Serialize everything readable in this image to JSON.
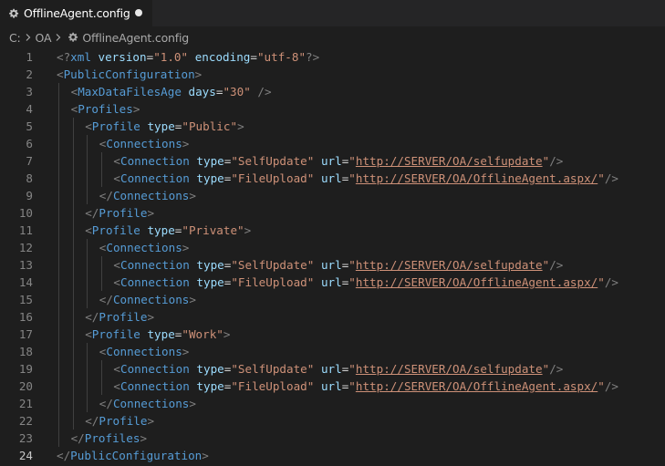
{
  "tab": {
    "title": "OfflineAgent.config",
    "icon": "gear-icon",
    "unsaved": true
  },
  "breadcrumb": {
    "segments": [
      "C:",
      "OA",
      "OfflineAgent.config"
    ],
    "separator_icon": "chevron-right-icon",
    "file_icon": "gear-icon"
  },
  "editor": {
    "current_line": 24,
    "lines": [
      {
        "n": "1",
        "indent": 0,
        "tokens": [
          [
            "punct",
            "<?"
          ],
          [
            "tag",
            "xml"
          ],
          [
            "sp",
            " "
          ],
          [
            "attr",
            "version"
          ],
          [
            "eq",
            "="
          ],
          [
            "str",
            "\"1.0\""
          ],
          [
            "sp",
            " "
          ],
          [
            "attr",
            "encoding"
          ],
          [
            "eq",
            "="
          ],
          [
            "str",
            "\"utf-8\""
          ],
          [
            "punct",
            "?>"
          ]
        ]
      },
      {
        "n": "2",
        "indent": 0,
        "tokens": [
          [
            "punct",
            "<"
          ],
          [
            "tag",
            "PublicConfiguration"
          ],
          [
            "punct",
            ">"
          ]
        ]
      },
      {
        "n": "3",
        "indent": 1,
        "tokens": [
          [
            "punct",
            "<"
          ],
          [
            "tag",
            "MaxDataFilesAge"
          ],
          [
            "sp",
            " "
          ],
          [
            "attr",
            "days"
          ],
          [
            "eq",
            "="
          ],
          [
            "str",
            "\"30\""
          ],
          [
            "sp",
            " "
          ],
          [
            "punct",
            "/>"
          ]
        ]
      },
      {
        "n": "4",
        "indent": 1,
        "tokens": [
          [
            "punct",
            "<"
          ],
          [
            "tag",
            "Profiles"
          ],
          [
            "punct",
            ">"
          ]
        ]
      },
      {
        "n": "5",
        "indent": 2,
        "tokens": [
          [
            "punct",
            "<"
          ],
          [
            "tag",
            "Profile"
          ],
          [
            "sp",
            " "
          ],
          [
            "attr",
            "type"
          ],
          [
            "eq",
            "="
          ],
          [
            "str",
            "\"Public\""
          ],
          [
            "punct",
            ">"
          ]
        ]
      },
      {
        "n": "6",
        "indent": 3,
        "tokens": [
          [
            "punct",
            "<"
          ],
          [
            "tag",
            "Connections"
          ],
          [
            "punct",
            ">"
          ]
        ]
      },
      {
        "n": "7",
        "indent": 4,
        "tokens": [
          [
            "punct",
            "<"
          ],
          [
            "tag",
            "Connection"
          ],
          [
            "sp",
            " "
          ],
          [
            "attr",
            "type"
          ],
          [
            "eq",
            "="
          ],
          [
            "str",
            "\"SelfUpdate\""
          ],
          [
            "sp",
            " "
          ],
          [
            "attr",
            "url"
          ],
          [
            "eq",
            "="
          ],
          [
            "str",
            "\""
          ],
          [
            "url",
            "http://SERVER/OA/selfupdate"
          ],
          [
            "str",
            "\""
          ],
          [
            "punct",
            "/>"
          ]
        ]
      },
      {
        "n": "8",
        "indent": 4,
        "tokens": [
          [
            "punct",
            "<"
          ],
          [
            "tag",
            "Connection"
          ],
          [
            "sp",
            " "
          ],
          [
            "attr",
            "type"
          ],
          [
            "eq",
            "="
          ],
          [
            "str",
            "\"FileUpload\""
          ],
          [
            "sp",
            " "
          ],
          [
            "attr",
            "url"
          ],
          [
            "eq",
            "="
          ],
          [
            "str",
            "\""
          ],
          [
            "url",
            "http://SERVER/OA/OfflineAgent.aspx/"
          ],
          [
            "str",
            "\""
          ],
          [
            "punct",
            "/>"
          ]
        ]
      },
      {
        "n": "9",
        "indent": 3,
        "tokens": [
          [
            "punct",
            "</"
          ],
          [
            "tag",
            "Connections"
          ],
          [
            "punct",
            ">"
          ]
        ]
      },
      {
        "n": "10",
        "indent": 2,
        "tokens": [
          [
            "punct",
            "</"
          ],
          [
            "tag",
            "Profile"
          ],
          [
            "punct",
            ">"
          ]
        ]
      },
      {
        "n": "11",
        "indent": 2,
        "tokens": [
          [
            "punct",
            "<"
          ],
          [
            "tag",
            "Profile"
          ],
          [
            "sp",
            " "
          ],
          [
            "attr",
            "type"
          ],
          [
            "eq",
            "="
          ],
          [
            "str",
            "\"Private\""
          ],
          [
            "punct",
            ">"
          ]
        ]
      },
      {
        "n": "12",
        "indent": 3,
        "tokens": [
          [
            "punct",
            "<"
          ],
          [
            "tag",
            "Connections"
          ],
          [
            "punct",
            ">"
          ]
        ]
      },
      {
        "n": "13",
        "indent": 4,
        "tokens": [
          [
            "punct",
            "<"
          ],
          [
            "tag",
            "Connection"
          ],
          [
            "sp",
            " "
          ],
          [
            "attr",
            "type"
          ],
          [
            "eq",
            "="
          ],
          [
            "str",
            "\"SelfUpdate\""
          ],
          [
            "sp",
            " "
          ],
          [
            "attr",
            "url"
          ],
          [
            "eq",
            "="
          ],
          [
            "str",
            "\""
          ],
          [
            "url",
            "http://SERVER/OA/selfupdate"
          ],
          [
            "str",
            "\""
          ],
          [
            "punct",
            "/>"
          ]
        ]
      },
      {
        "n": "14",
        "indent": 4,
        "tokens": [
          [
            "punct",
            "<"
          ],
          [
            "tag",
            "Connection"
          ],
          [
            "sp",
            " "
          ],
          [
            "attr",
            "type"
          ],
          [
            "eq",
            "="
          ],
          [
            "str",
            "\"FileUpload\""
          ],
          [
            "sp",
            " "
          ],
          [
            "attr",
            "url"
          ],
          [
            "eq",
            "="
          ],
          [
            "str",
            "\""
          ],
          [
            "url",
            "http://SERVER/OA/OfflineAgent.aspx/"
          ],
          [
            "str",
            "\""
          ],
          [
            "punct",
            "/>"
          ]
        ]
      },
      {
        "n": "15",
        "indent": 3,
        "tokens": [
          [
            "punct",
            "</"
          ],
          [
            "tag",
            "Connections"
          ],
          [
            "punct",
            ">"
          ]
        ]
      },
      {
        "n": "16",
        "indent": 2,
        "tokens": [
          [
            "punct",
            "</"
          ],
          [
            "tag",
            "Profile"
          ],
          [
            "punct",
            ">"
          ]
        ]
      },
      {
        "n": "17",
        "indent": 2,
        "tokens": [
          [
            "punct",
            "<"
          ],
          [
            "tag",
            "Profile"
          ],
          [
            "sp",
            " "
          ],
          [
            "attr",
            "type"
          ],
          [
            "eq",
            "="
          ],
          [
            "str",
            "\"Work\""
          ],
          [
            "punct",
            ">"
          ]
        ]
      },
      {
        "n": "18",
        "indent": 3,
        "tokens": [
          [
            "punct",
            "<"
          ],
          [
            "tag",
            "Connections"
          ],
          [
            "punct",
            ">"
          ]
        ]
      },
      {
        "n": "19",
        "indent": 4,
        "tokens": [
          [
            "punct",
            "<"
          ],
          [
            "tag",
            "Connection"
          ],
          [
            "sp",
            " "
          ],
          [
            "attr",
            "type"
          ],
          [
            "eq",
            "="
          ],
          [
            "str",
            "\"SelfUpdate\""
          ],
          [
            "sp",
            " "
          ],
          [
            "attr",
            "url"
          ],
          [
            "eq",
            "="
          ],
          [
            "str",
            "\""
          ],
          [
            "url",
            "http://SERVER/OA/selfupdate"
          ],
          [
            "str",
            "\""
          ],
          [
            "punct",
            "/>"
          ]
        ]
      },
      {
        "n": "20",
        "indent": 4,
        "tokens": [
          [
            "punct",
            "<"
          ],
          [
            "tag",
            "Connection"
          ],
          [
            "sp",
            " "
          ],
          [
            "attr",
            "type"
          ],
          [
            "eq",
            "="
          ],
          [
            "str",
            "\"FileUpload\""
          ],
          [
            "sp",
            " "
          ],
          [
            "attr",
            "url"
          ],
          [
            "eq",
            "="
          ],
          [
            "str",
            "\""
          ],
          [
            "url",
            "http://SERVER/OA/OfflineAgent.aspx/"
          ],
          [
            "str",
            "\""
          ],
          [
            "punct",
            "/>"
          ]
        ]
      },
      {
        "n": "21",
        "indent": 3,
        "tokens": [
          [
            "punct",
            "</"
          ],
          [
            "tag",
            "Connections"
          ],
          [
            "punct",
            ">"
          ]
        ]
      },
      {
        "n": "22",
        "indent": 2,
        "tokens": [
          [
            "punct",
            "</"
          ],
          [
            "tag",
            "Profile"
          ],
          [
            "punct",
            ">"
          ]
        ]
      },
      {
        "n": "23",
        "indent": 1,
        "tokens": [
          [
            "punct",
            "</"
          ],
          [
            "tag",
            "Profiles"
          ],
          [
            "punct",
            ">"
          ]
        ]
      },
      {
        "n": "24",
        "indent": 0,
        "tokens": [
          [
            "punct",
            "</"
          ],
          [
            "tag",
            "PublicConfiguration"
          ],
          [
            "punct",
            ">"
          ]
        ]
      }
    ]
  },
  "colors": {
    "background": "#1e1e1e",
    "tag": "#569cd6",
    "attribute": "#9cdcfe",
    "string": "#ce9178",
    "punctuation": "#808080",
    "line_number": "#858585"
  }
}
